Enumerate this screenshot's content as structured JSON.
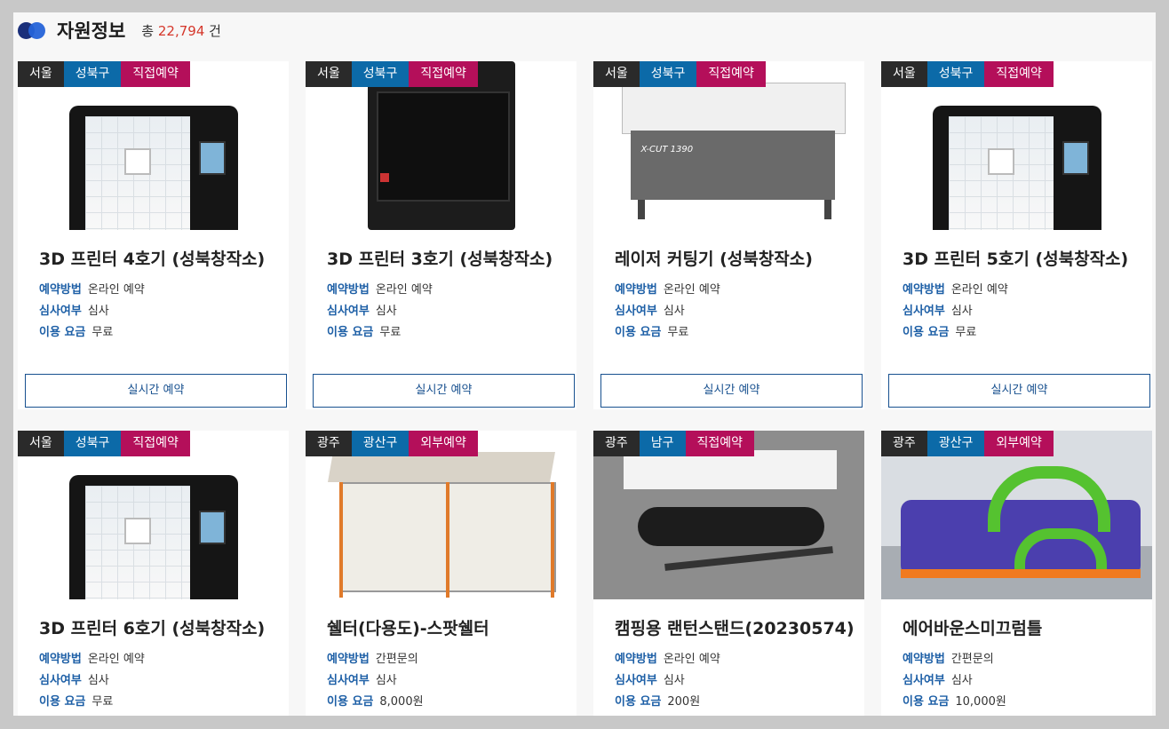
{
  "header": {
    "title": "자원정보",
    "count_prefix": "총",
    "count_value": "22,794",
    "count_suffix": "건"
  },
  "labels": {
    "method": "예약방법",
    "review": "심사여부",
    "fee": "이용 요금",
    "reserve_button": "실시간 예약"
  },
  "cards": [
    {
      "region": "서울",
      "district": "성북구",
      "mode": "직접예약",
      "title": "3D 프린터 4호기 (성북창작소)",
      "method": "온라인 예약",
      "review": "심사",
      "fee": "무료",
      "icon": "3d-printer-icon"
    },
    {
      "region": "서울",
      "district": "성북구",
      "mode": "직접예약",
      "title": "3D 프린터 3호기 (성북창작소)",
      "method": "온라인 예약",
      "review": "심사",
      "fee": "무료",
      "icon": "3d-printer-icon"
    },
    {
      "region": "서울",
      "district": "성북구",
      "mode": "직접예약",
      "title": "레이저 커팅기 (성북창작소)",
      "method": "온라인 예약",
      "review": "심사",
      "fee": "무료",
      "icon": "laser-cutter-icon",
      "image_text": "X-CUT 1390"
    },
    {
      "region": "서울",
      "district": "성북구",
      "mode": "직접예약",
      "title": "3D 프린터 5호기 (성북창작소)",
      "method": "온라인 예약",
      "review": "심사",
      "fee": "무료",
      "icon": "3d-printer-icon"
    },
    {
      "region": "서울",
      "district": "성북구",
      "mode": "직접예약",
      "title": "3D 프린터 6호기 (성북창작소)",
      "method": "온라인 예약",
      "review": "심사",
      "fee": "무료",
      "icon": "3d-printer-icon"
    },
    {
      "region": "광주",
      "district": "광산구",
      "mode": "외부예약",
      "title": "쉘터(다용도)-스팟쉘터",
      "method": "간편문의",
      "review": "심사",
      "fee": "8,000원",
      "icon": "shelter-tent-icon"
    },
    {
      "region": "광주",
      "district": "남구",
      "mode": "직접예약",
      "title": "캠핑용 랜턴스탠드(20230574)",
      "method": "온라인 예약",
      "review": "심사",
      "fee": "200원",
      "icon": "lantern-stand-icon"
    },
    {
      "region": "광주",
      "district": "광산구",
      "mode": "외부예약",
      "title": "에어바운스미끄럼틀",
      "method": "간편문의",
      "review": "심사",
      "fee": "10,000원",
      "icon": "air-bounce-slide-icon"
    }
  ]
}
